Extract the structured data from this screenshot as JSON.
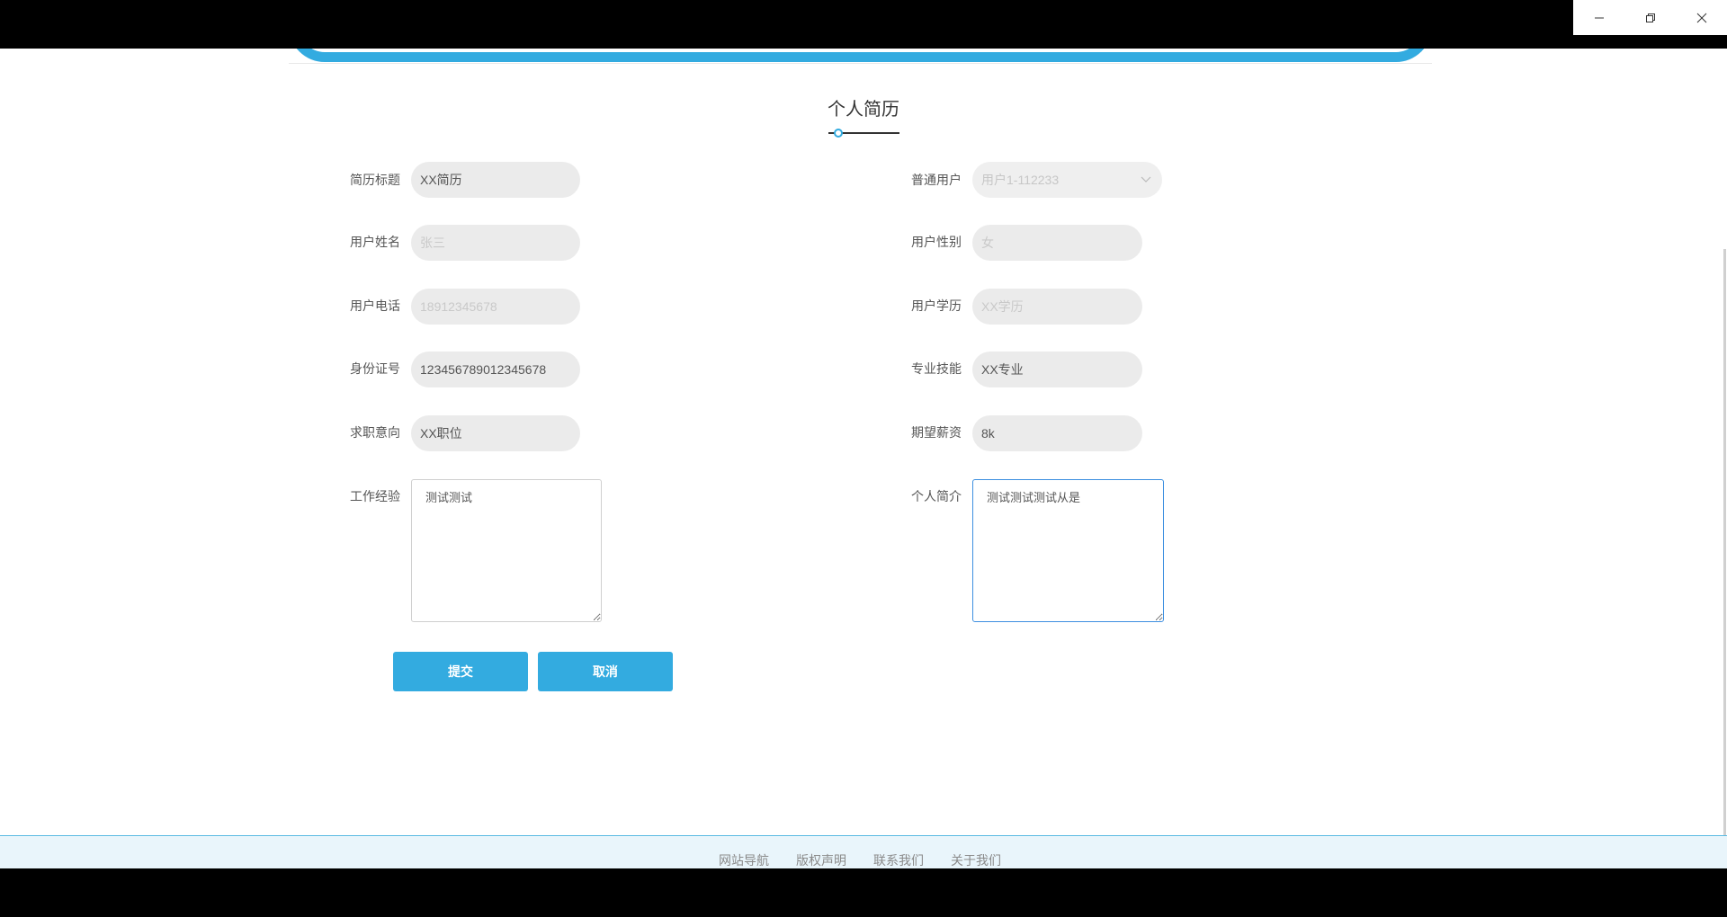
{
  "window": {
    "controls": [
      "minimize-icon",
      "restore-icon",
      "close-icon"
    ]
  },
  "page": {
    "title": "个人简历"
  },
  "form": {
    "resume_title": {
      "label": "简历标题",
      "value": "XX简历"
    },
    "user_name": {
      "label": "用户姓名",
      "placeholder": "张三"
    },
    "user_phone": {
      "label": "用户电话",
      "placeholder": "18912345678"
    },
    "id_number": {
      "label": "身份证号",
      "value": "123456789012345678"
    },
    "job_intention": {
      "label": "求职意向",
      "value": "XX职位"
    },
    "work_experience": {
      "label": "工作经验",
      "value": "测试测试"
    },
    "normal_user": {
      "label": "普通用户",
      "selected": "用户1-112233"
    },
    "user_gender": {
      "label": "用户性别",
      "placeholder": "女"
    },
    "user_education": {
      "label": "用户学历",
      "placeholder": "XX学历"
    },
    "skills": {
      "label": "专业技能",
      "value": "XX专业"
    },
    "expected_salary": {
      "label": "期望薪资",
      "value": "8k"
    },
    "self_intro": {
      "label": "个人简介",
      "value": "测试测试测试从是"
    }
  },
  "buttons": {
    "submit": "提交",
    "cancel": "取消"
  },
  "footer": {
    "links": [
      "网站导航",
      "版权声明",
      "联系我们",
      "关于我们"
    ]
  },
  "colors": {
    "accent": "#33abe0",
    "footer_bg": "#e9f5fb",
    "focus_border": "#3d8fe0"
  }
}
